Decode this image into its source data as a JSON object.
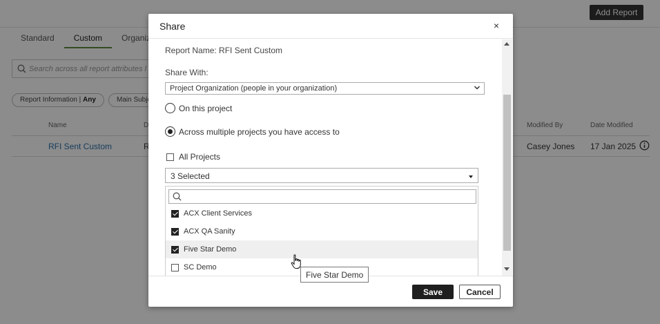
{
  "background": {
    "add_report_label": "Add Report",
    "tabs": [
      {
        "label": "Standard"
      },
      {
        "label": "Custom"
      },
      {
        "label": "Organiz"
      }
    ],
    "search_placeholder": "Search across all report attributes l",
    "filters": [
      {
        "name": "Report Information",
        "value": "Any"
      },
      {
        "name": "Main Subje",
        "value": ""
      }
    ],
    "columns": {
      "name": "Name",
      "d": "D",
      "modified_by": "Modified By",
      "date_modified": "Date Modified"
    },
    "rows": [
      {
        "name": "RFI Sent Custom",
        "d": "R",
        "modified_by": "Casey Jones",
        "date_modified": "17 Jan 2025"
      }
    ]
  },
  "modal": {
    "title": "Share",
    "close_glyph": "×",
    "report_name": "Report Name: RFI Sent Custom",
    "share_with_label": "Share With:",
    "share_with_value": "Project Organization (people in your organization)",
    "radio_options": [
      {
        "label": "On this project",
        "checked": false
      },
      {
        "label": "Across multiple projects you have access to",
        "checked": true
      }
    ],
    "all_projects_label": "All Projects",
    "all_projects_checked": false,
    "projects_select_value": "3 Selected",
    "projects": [
      {
        "label": "ACX Client Services",
        "checked": true
      },
      {
        "label": "ACX QA Sanity",
        "checked": true
      },
      {
        "label": "Five Star Demo",
        "checked": true
      },
      {
        "label": "SC Demo",
        "checked": false
      }
    ],
    "save_label": "Save",
    "cancel_label": "Cancel"
  },
  "tooltip": "Five Star Demo",
  "colors": {
    "overlay": "#000000",
    "link": "#2a6ea6",
    "active_tab_underline": "#5a8a3c",
    "primary_button": "#1f1f1f"
  }
}
